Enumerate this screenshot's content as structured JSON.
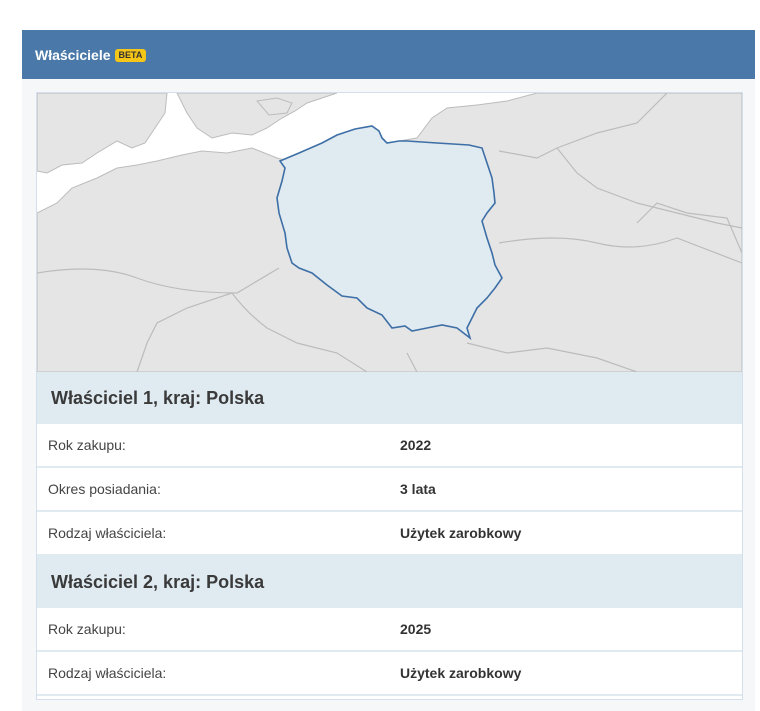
{
  "header": {
    "title": "Właściciele",
    "badge": "BETA"
  },
  "map": {
    "highlighted_country": "Polska",
    "highlight_color": "#dfeaf1",
    "border_color": "#3d6fa6",
    "land_color": "#e5e5e5",
    "water_color": "#ffffff"
  },
  "owners": [
    {
      "title": "Właściciel 1, kraj: Polska",
      "rows": [
        {
          "label": "Rok zakupu:",
          "value": "2022"
        },
        {
          "label": "Okres posiadania:",
          "value": "3 lata"
        },
        {
          "label": "Rodzaj właściciela:",
          "value": "Użytek zarobkowy"
        }
      ]
    },
    {
      "title": "Właściciel 2, kraj: Polska",
      "rows": [
        {
          "label": "Rok zakupu:",
          "value": "2025"
        },
        {
          "label": "Rodzaj właściciela:",
          "value": "Użytek zarobkowy"
        }
      ]
    }
  ]
}
